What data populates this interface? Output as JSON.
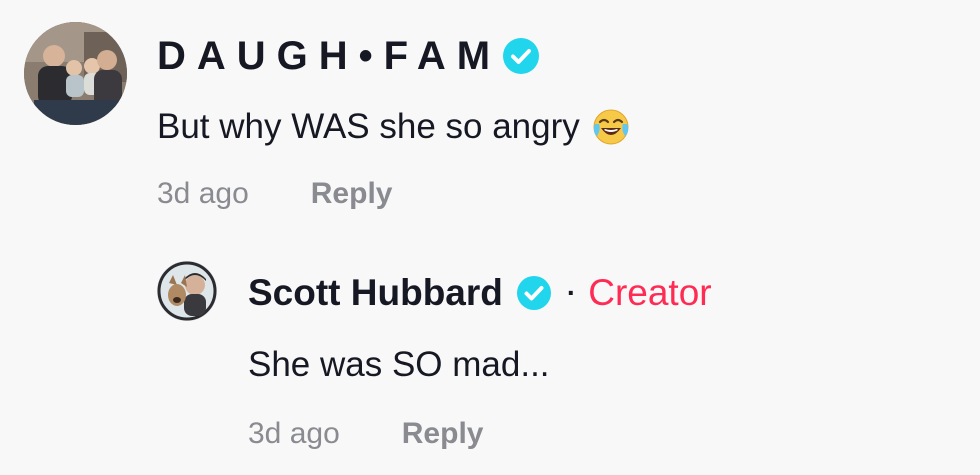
{
  "comment": {
    "username": "DAUGH•FAM",
    "text": "But why WAS she so angry",
    "emoji": "face-with-tears-of-joy",
    "time": "3d ago",
    "reply_label": "Reply"
  },
  "reply": {
    "username": "Scott Hubbard",
    "separator": "·",
    "badge": "Creator",
    "text": "She was SO mad...",
    "time": "3d ago",
    "reply_label": "Reply"
  },
  "colors": {
    "verified": "#20d5ec",
    "creator": "#fe2c55",
    "meta": "#8a8b91",
    "text": "#161823"
  }
}
